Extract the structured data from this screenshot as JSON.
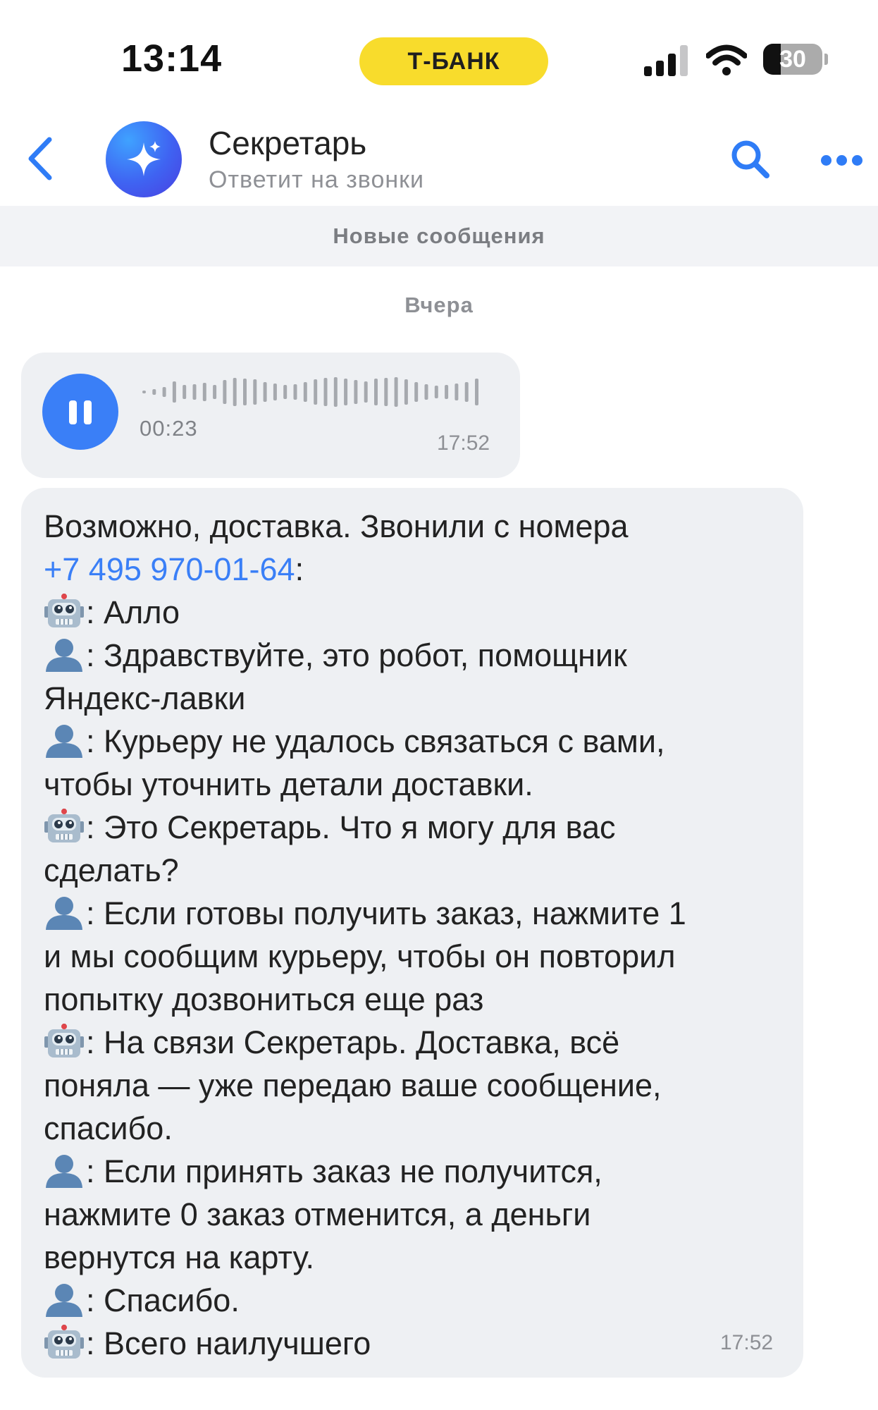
{
  "status_bar": {
    "time": "13:14",
    "bank_badge": "Т-БАНК",
    "battery_level": "30",
    "battery_percent": 30
  },
  "header": {
    "title": "Секретарь",
    "subtitle": "Ответит на звонки"
  },
  "banner": {
    "new_messages": "Новые сообщения"
  },
  "date_separator": "Вчера",
  "voice_message": {
    "duration": "00:23",
    "time": "17:52"
  },
  "text_message": {
    "time": "17:52",
    "intro_line1": "Возможно, доставка. Звонили с номера",
    "phone": "+7 495 970-01-64",
    "phone_suffix": ":",
    "lines": [
      {
        "speaker": "robot",
        "text": ": Алло"
      },
      {
        "speaker": "person",
        "text": ": Здравствуйте, это робот, помощник"
      },
      {
        "speaker": "",
        "text": "Яндекс-лавки"
      },
      {
        "speaker": "person",
        "text": ": Курьеру не удалось связаться с вами,"
      },
      {
        "speaker": "",
        "text": "чтобы уточнить детали доставки."
      },
      {
        "speaker": "robot",
        "text": ": Это Секретарь. Что я могу для вас"
      },
      {
        "speaker": "",
        "text": "сделать?"
      },
      {
        "speaker": "person",
        "text": ": Если готовы получить заказ, нажмите 1"
      },
      {
        "speaker": "",
        "text": "и мы сообщим курьеру, чтобы он повторил"
      },
      {
        "speaker": "",
        "text": "попытку дозвониться еще раз"
      },
      {
        "speaker": "robot",
        "text": ": На связи Секретарь. Доставка, всё"
      },
      {
        "speaker": "",
        "text": "поняла — уже передаю ваше сообщение,"
      },
      {
        "speaker": "",
        "text": "спасибо."
      },
      {
        "speaker": "person",
        "text": ": Если принять заказ не получится,"
      },
      {
        "speaker": "",
        "text": "нажмите 0 заказ отменится, а деньги"
      },
      {
        "speaker": "",
        "text": "вернутся на карту."
      },
      {
        "speaker": "person",
        "text": ": Спасибо."
      },
      {
        "speaker": "robot",
        "text": ": Всего наилучшего"
      }
    ]
  },
  "icons": {
    "back": "chevron-left-icon",
    "avatar": "sparkle-icon",
    "search": "search-icon",
    "more": "more-dots-icon",
    "play": "pause-icon",
    "robot": "robot-face-icon",
    "person": "person-silhouette-icon"
  },
  "colors": {
    "accent": "#3a7ff7",
    "bank_yellow": "#f8dc2c",
    "bubble_bg": "#eef0f3",
    "muted_text": "#8e9095"
  }
}
